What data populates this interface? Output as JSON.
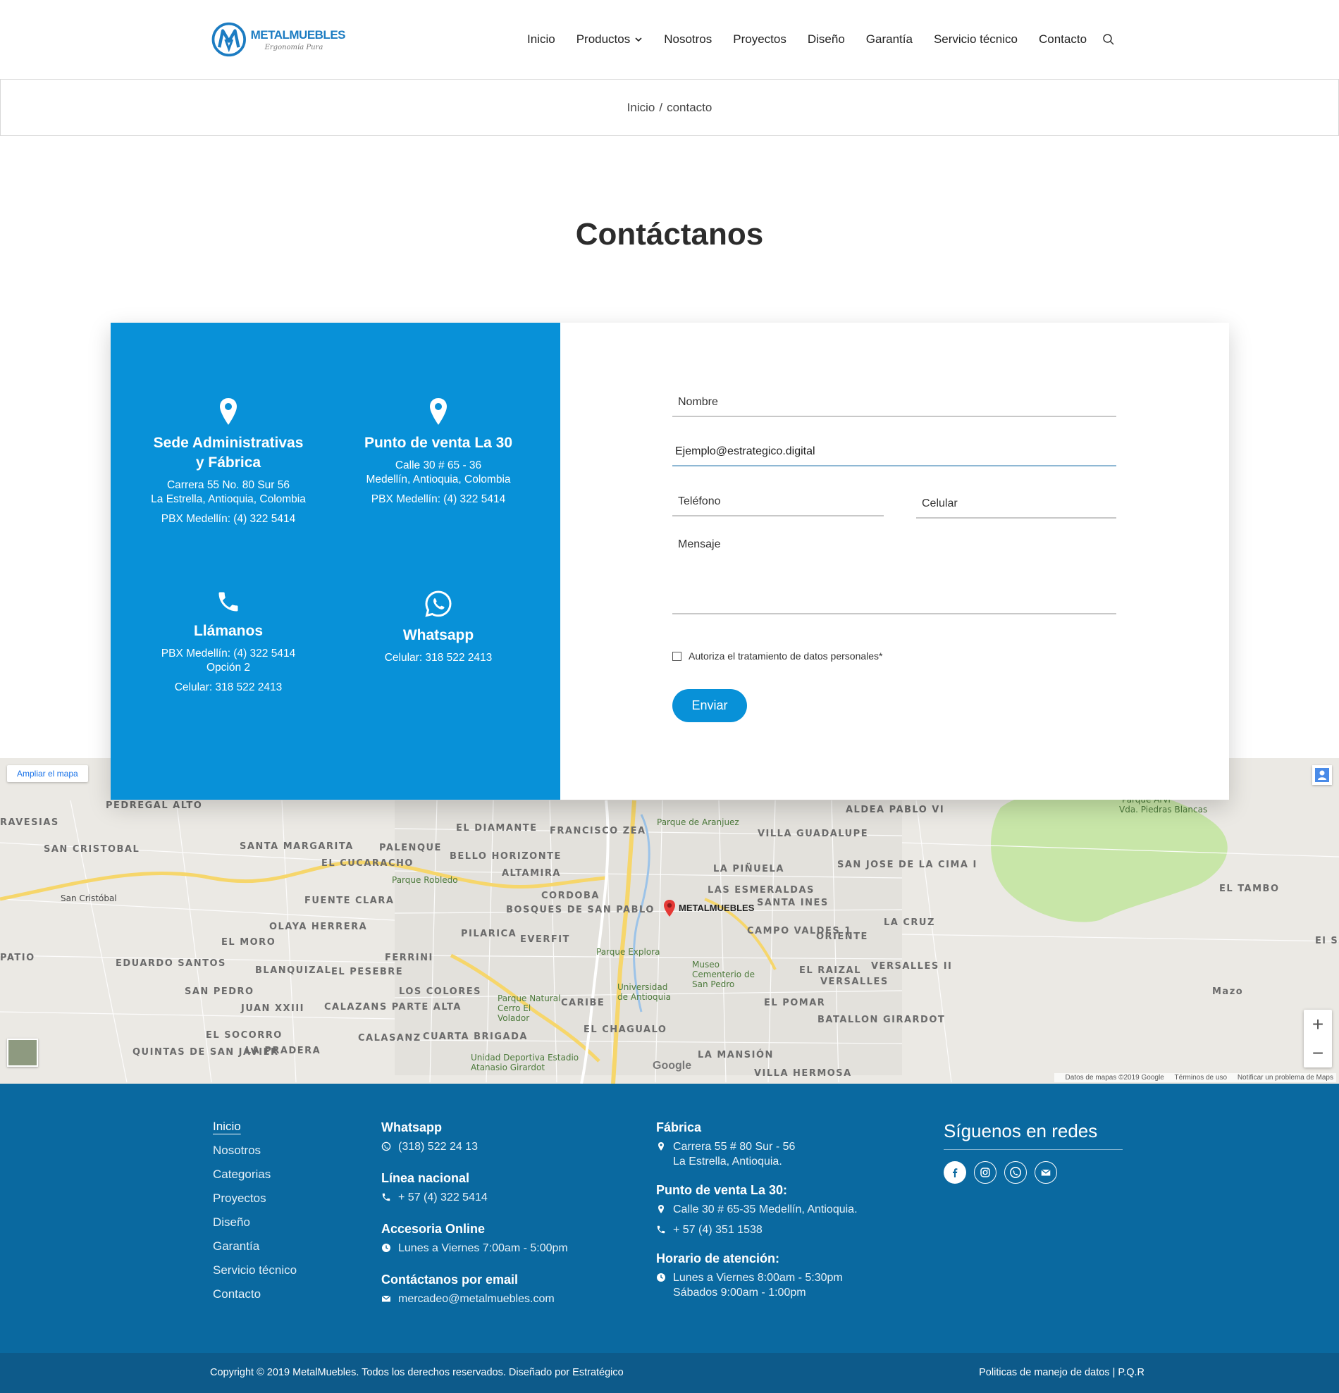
{
  "brand": {
    "name": "METALMUEBLES",
    "tagline": "Ergonomía Pura",
    "color": "#1c7cc2"
  },
  "nav": {
    "items": [
      "Inicio",
      "Productos",
      "Nosotros",
      "Proyectos",
      "Diseño",
      "Garantía",
      "Servicio técnico",
      "Contacto"
    ]
  },
  "breadcrumb": {
    "home": "Inicio",
    "sep": "/",
    "current": "contacto"
  },
  "page_title": "Contáctanos",
  "contact": {
    "color": "#0891d8",
    "sede": {
      "title1": "Sede Administrativas",
      "title2": "y Fábrica",
      "line1": "Carrera 55 No. 80 Sur 56",
      "line2": "La Estrella, Antioquia, Colombia",
      "pbx": "PBX Medellín: (4) 322 5414"
    },
    "punto": {
      "title": "Punto de venta La 30",
      "line1": "Calle 30 # 65 - 36",
      "line2": "Medellín, Antioquia, Colombia",
      "pbx": "PBX Medellín: (4) 322 5414"
    },
    "llamanos": {
      "title": "Llámanos",
      "line1": "PBX Medellín: (4) 322 5414",
      "line2": "Opción 2",
      "cel": "Celular: 318 522 2413"
    },
    "whatsapp": {
      "title": "Whatsapp",
      "cel": "Celular: 318 522 2413"
    }
  },
  "form": {
    "nombre_placeholder": "Nombre",
    "email_value": "Ejemplo@estrategico.digital",
    "telefono_placeholder": "Teléfono",
    "celular_placeholder": "Celular",
    "mensaje_placeholder": "Mensaje",
    "consent": "Autoriza el tratamiento de datos personales*",
    "submit": "Enviar"
  },
  "map": {
    "expand": "Ampliar el mapa",
    "marker": "METALMUEBLES",
    "labels": [
      "PEDREGAL ALTO",
      "RAVESIAS",
      "SAN CRISTOBAL",
      "SANTA MARGARITA",
      "PALENQUE",
      "EL DIAMANTE",
      "FRANCISCO ZEA",
      "VILLA GUADALUPE",
      "ALDEA PABLO VI",
      "EL CUCARACHO",
      "BELLO HORIZONTE",
      "ALTAMIRA",
      "LA PIÑUELA",
      "SAN JOSE DE LA CIMA I",
      "LAS ESMERALDAS",
      "SANTA INES",
      "FUENTE CLARA",
      "CORDOBA",
      "BOSQUES DE SAN PABLO",
      "OLAYA HERRERA",
      "PILARICA",
      "EVERFIT",
      "CAMPO VALDES 1",
      "ORIENTE",
      "LA CRUZ",
      "EL MORO",
      "PATIO",
      "FERRINI",
      "EDUARDO SANTOS",
      "BLANQUIZAL",
      "EL PESEBRE",
      "EL RAIZAL",
      "VERSALLES",
      "VERSALLES II",
      "SAN PEDRO",
      "LOS COLORES",
      "JUAN XXIII",
      "CALAZANS PARTE ALTA",
      "CARIBE",
      "EL POMAR",
      "BATALLON GIRARDOT",
      "EL SOCORRO",
      "CALASANZ",
      "CUARTA BRIGADA",
      "EL CHAGUALO",
      "QUINTAS DE SAN JAVIER",
      "LA PRADERA",
      "LA MANSIÓN",
      "VILLA HERMOSA",
      "EL TAMBO",
      "Mazo",
      "El Sa"
    ],
    "places": [
      "Parque de Aranjuez",
      "Parque Robledo",
      "Parque Explora",
      "Museo Cementerio de San Pedro",
      "Universidad de Antioquia",
      "Parque Natural Cerro El Volador",
      "Unidad Deportiva Estadio Atanasio Girardot",
      "Parque Arví",
      "Vda. Piedras Blancas",
      "San Cristóbal"
    ],
    "credits": [
      "Datos de mapas ©2019 Google",
      "Términos de uso",
      "Notificar un problema de Maps"
    ],
    "google": "Google"
  },
  "footer": {
    "links": [
      "Inicio",
      "Nosotros",
      "Categorias",
      "Proyectos",
      "Diseño",
      "Garantía",
      "Servicio técnico",
      "Contacto"
    ],
    "whatsapp_title": "Whatsapp",
    "whatsapp": "(318) 522 24 13",
    "linea_title": "Línea nacional",
    "linea": "+ 57 (4) 322 5414",
    "accesoria_title": "Accesoria Online",
    "accesoria": "Lunes a Viernes 7:00am - 5:00pm",
    "email_title": "Contáctanos por email",
    "email": "mercadeo@metalmuebles.com",
    "fabrica_title": "Fábrica",
    "fabrica1": "Carrera 55 # 80 Sur - 56",
    "fabrica2": "La Estrella, Antioquia.",
    "punto_title": "Punto de venta La 30:",
    "punto_dir": "Calle 30 # 65-35 Medellín, Antioquia.",
    "punto_tel": "+ 57 (4) 351 1538",
    "horario_title": "Horario de atención:",
    "horario1": "Lunes a Viernes 8:00am - 5:30pm",
    "horario2": "Sábados 9:00am - 1:00pm",
    "social_title": "Síguenos en redes",
    "bg": "#0a69a0"
  },
  "bottom": {
    "copyright": "Copyright © 2019 MetalMuebles. Todos los derechos reservados. Diseñado por Estratégico",
    "policy": "Politicas de manejo de datos",
    "sep": "|",
    "pqr": "P.Q.R"
  }
}
